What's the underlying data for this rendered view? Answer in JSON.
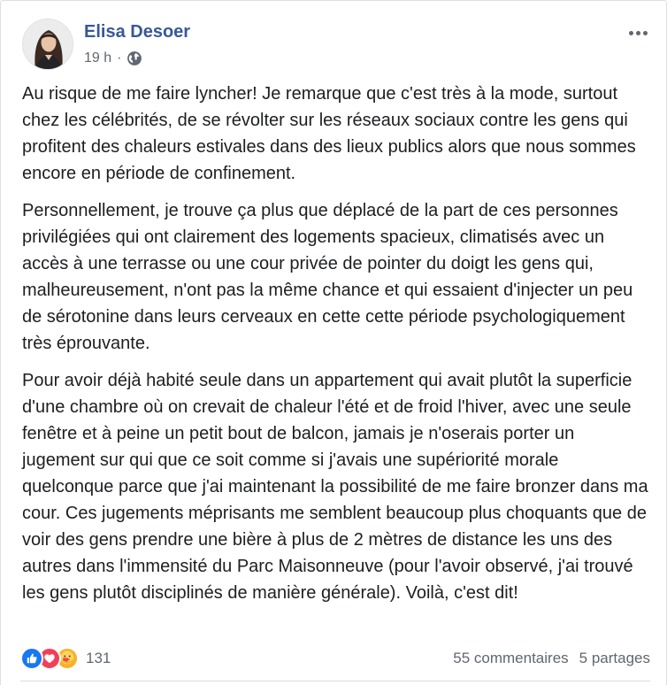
{
  "post": {
    "author": "Elisa Desoer",
    "time": "19 h",
    "separator": "·",
    "audience_icon": "globe-icon",
    "more_icon": "more-options-icon",
    "paragraphs": [
      "Au risque de me faire lyncher! Je remarque que c'est très à la mode, surtout chez les célébrités, de se révolter sur les réseaux sociaux contre les gens qui profitent des chaleurs estivales dans des lieux publics alors que nous sommes encore en période de confinement.",
      "Personnellement, je trouve ça plus que déplacé de la part de ces personnes privilégiées qui ont clairement des logements spacieux, climatisés avec un accès à une terrasse ou une cour privée de pointer du doigt les gens qui, malheureusement, n'ont pas la même chance et qui essaient d'injecter un peu de sérotonine dans leurs cerveaux en cette cette période psychologiquement très éprouvante.",
      "Pour avoir déjà habité seule dans un appartement qui avait plutôt la superficie d'une chambre où on crevait de chaleur l'été et de froid l'hiver, avec une seule fenêtre et à peine un petit bout de balcon, jamais je n'oserais porter un jugement sur qui que ce soit comme si j'avais une supériorité morale quelconque parce que j'ai maintenant la possibilité de me faire bronzer dans ma cour. Ces jugements méprisants me semblent beaucoup plus choquants que de voir des gens prendre une bière à plus de 2 mètres de distance les uns des autres dans l'immensité du Parc Maisonneuve (pour l'avoir observé, j'ai trouvé les gens plutôt disciplinés de manière générale). Voilà, c'est dit!"
    ]
  },
  "footer": {
    "reaction_icons": [
      "like-icon",
      "love-icon",
      "care-icon"
    ],
    "reaction_count": "131",
    "comments": "55 commentaires",
    "shares": "5 partages"
  },
  "colors": {
    "author_link": "#385898",
    "secondary_text": "#606770",
    "like": "#1877f2",
    "love": "#f33e58",
    "care": "#f7b125"
  }
}
